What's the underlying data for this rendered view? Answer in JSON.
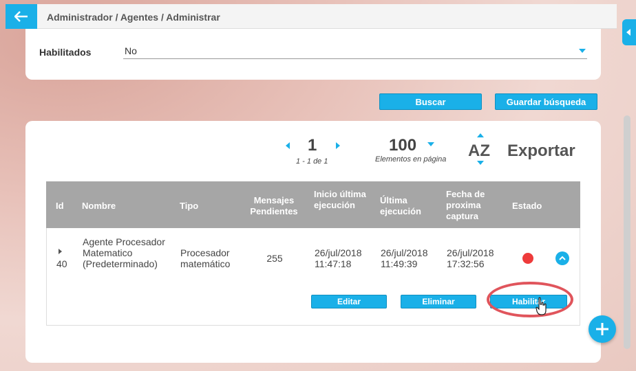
{
  "header": {
    "breadcrumb": "Administrador / Agentes / Administrar",
    "back_icon": "arrow-left-icon"
  },
  "filters": {
    "enabled_label": "Habilitados",
    "enabled_value": "No"
  },
  "actions": {
    "search_label": "Buscar",
    "save_search_label": "Guardar búsqueda"
  },
  "pagination": {
    "current_page": "1",
    "range_text": "1 - 1 de 1",
    "page_size": "100",
    "page_size_label": "Elementos en página",
    "sort_label": "AZ",
    "export_label": "Exportar"
  },
  "table": {
    "columns": [
      "Id",
      "Nombre",
      "Tipo",
      "Mensajes Pendientes",
      "Inicio última ejecución",
      "Última ejecución",
      "Fecha de proxima captura",
      "Estado"
    ],
    "rows": [
      {
        "id": "40",
        "name": "Agente Procesador Matematico (Predeterminado)",
        "type": "Procesador matemático",
        "pending": "255",
        "start_last": "26/jul/2018 11:47:18",
        "last_exec": "26/jul/2018 11:49:39",
        "next_capture": "26/jul/2018 17:32:56",
        "status_color": "#ee3b3b"
      }
    ],
    "row_actions": {
      "edit_label": "Editar",
      "delete_label": "Eliminar",
      "enable_label": "Habilitar"
    }
  },
  "colors": {
    "accent": "#1ab0e8",
    "status_disabled": "#ee3b3b",
    "highlight": "#e0555c"
  }
}
